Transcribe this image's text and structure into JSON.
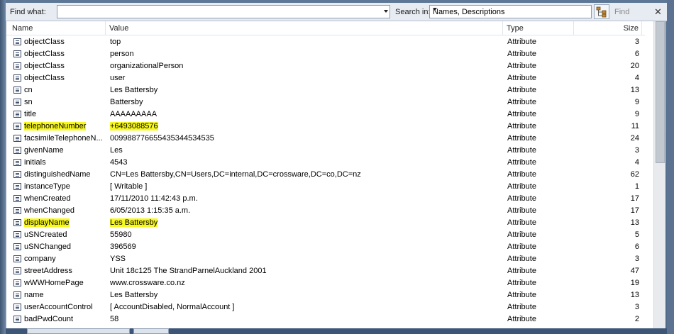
{
  "toolbar": {
    "find_what_label": "Find what:",
    "find_value": "",
    "search_in_label": "Search in:",
    "search_in_value": "Names, Descriptions",
    "find_button": "Find",
    "close_glyph": "✕"
  },
  "columns": {
    "name": "Name",
    "value": "Value",
    "type": "Type",
    "size": "Size"
  },
  "rows": [
    {
      "name": "objectClass",
      "value": "top",
      "type": "Attribute",
      "size": "3"
    },
    {
      "name": "objectClass",
      "value": "person",
      "type": "Attribute",
      "size": "6"
    },
    {
      "name": "objectClass",
      "value": "organizationalPerson",
      "type": "Attribute",
      "size": "20"
    },
    {
      "name": "objectClass",
      "value": "user",
      "type": "Attribute",
      "size": "4"
    },
    {
      "name": "cn",
      "value": "Les Battersby",
      "type": "Attribute",
      "size": "13"
    },
    {
      "name": "sn",
      "value": "Battersby",
      "type": "Attribute",
      "size": "9"
    },
    {
      "name": "title",
      "value": "AAAAAAAAA",
      "type": "Attribute",
      "size": "9"
    },
    {
      "name": "telephoneNumber",
      "value": "+6493088576",
      "type": "Attribute",
      "size": "11",
      "highlight": true
    },
    {
      "name": "facsimileTelephoneN...",
      "value": "009988776655435344534535",
      "type": "Attribute",
      "size": "24"
    },
    {
      "name": "givenName",
      "value": "Les",
      "type": "Attribute",
      "size": "3"
    },
    {
      "name": "initials",
      "value": "4543",
      "type": "Attribute",
      "size": "4"
    },
    {
      "name": "distinguishedName",
      "value": "CN=Les Battersby,CN=Users,DC=internal,DC=crossware,DC=co,DC=nz",
      "type": "Attribute",
      "size": "62"
    },
    {
      "name": "instanceType",
      "value": "[ Writable ]",
      "type": "Attribute",
      "size": "1"
    },
    {
      "name": "whenCreated",
      "value": "17/11/2010 11:42:43 p.m.",
      "type": "Attribute",
      "size": "17"
    },
    {
      "name": "whenChanged",
      "value": "6/05/2013 1:15:35 a.m.",
      "type": "Attribute",
      "size": "17"
    },
    {
      "name": "displayName",
      "value": "Les Battersby",
      "type": "Attribute",
      "size": "13",
      "highlight": true
    },
    {
      "name": "uSNCreated",
      "value": "55980",
      "type": "Attribute",
      "size": "5"
    },
    {
      "name": "uSNChanged",
      "value": "396569",
      "type": "Attribute",
      "size": "6"
    },
    {
      "name": "company",
      "value": "YSS",
      "type": "Attribute",
      "size": "3"
    },
    {
      "name": "streetAddress",
      "value": "Unit 18c125 The StrandParnelAuckland 2001",
      "type": "Attribute",
      "size": "47"
    },
    {
      "name": "wWWHomePage",
      "value": "www.crossware.co.nz",
      "type": "Attribute",
      "size": "19"
    },
    {
      "name": "name",
      "value": "Les Battersby",
      "type": "Attribute",
      "size": "13"
    },
    {
      "name": "userAccountControl",
      "value": "[ AccountDisabled, NormalAccount ]",
      "type": "Attribute",
      "size": "3"
    },
    {
      "name": "badPwdCount",
      "value": "58",
      "type": "Attribute",
      "size": "2"
    }
  ]
}
